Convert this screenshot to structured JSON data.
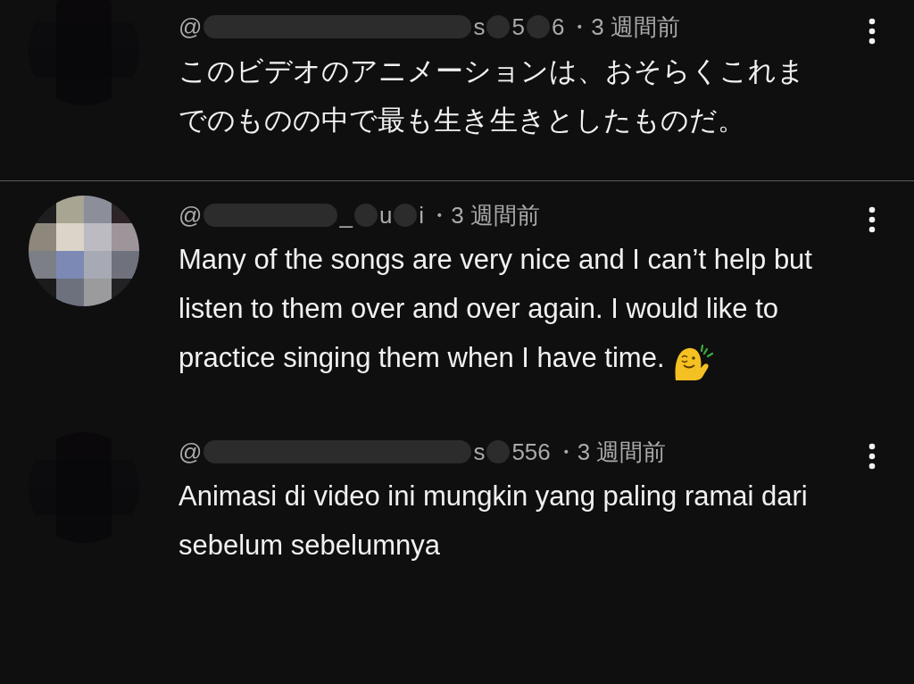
{
  "comments": [
    {
      "avatar": {
        "kind": "dark"
      },
      "handle": "@",
      "handle_fragments": [
        "s",
        "5",
        "6"
      ],
      "time": "・3 週間前",
      "text": "このビデオのアニメーションは、おそらくこれまでのものの中で最も生き生きとしたものだ。",
      "emoji": false,
      "divider_after": true
    },
    {
      "avatar": {
        "kind": "light"
      },
      "handle": "@",
      "handle_fragments": [
        "_",
        "u",
        "i"
      ],
      "time": "・3 週間前",
      "text": "Many of the songs are very nice and I can’t help but listen to them over and over again. I would like to practice singing them when I have time.",
      "emoji": true,
      "divider_after": false
    },
    {
      "avatar": {
        "kind": "dark"
      },
      "handle": "@",
      "handle_fragments": [
        "s",
        "556"
      ],
      "time": "・3 週間前",
      "text": "Animasi di video ini mungkin yang paling ramai dari sebelum sebelumnya",
      "emoji": false,
      "divider_after": false
    }
  ]
}
